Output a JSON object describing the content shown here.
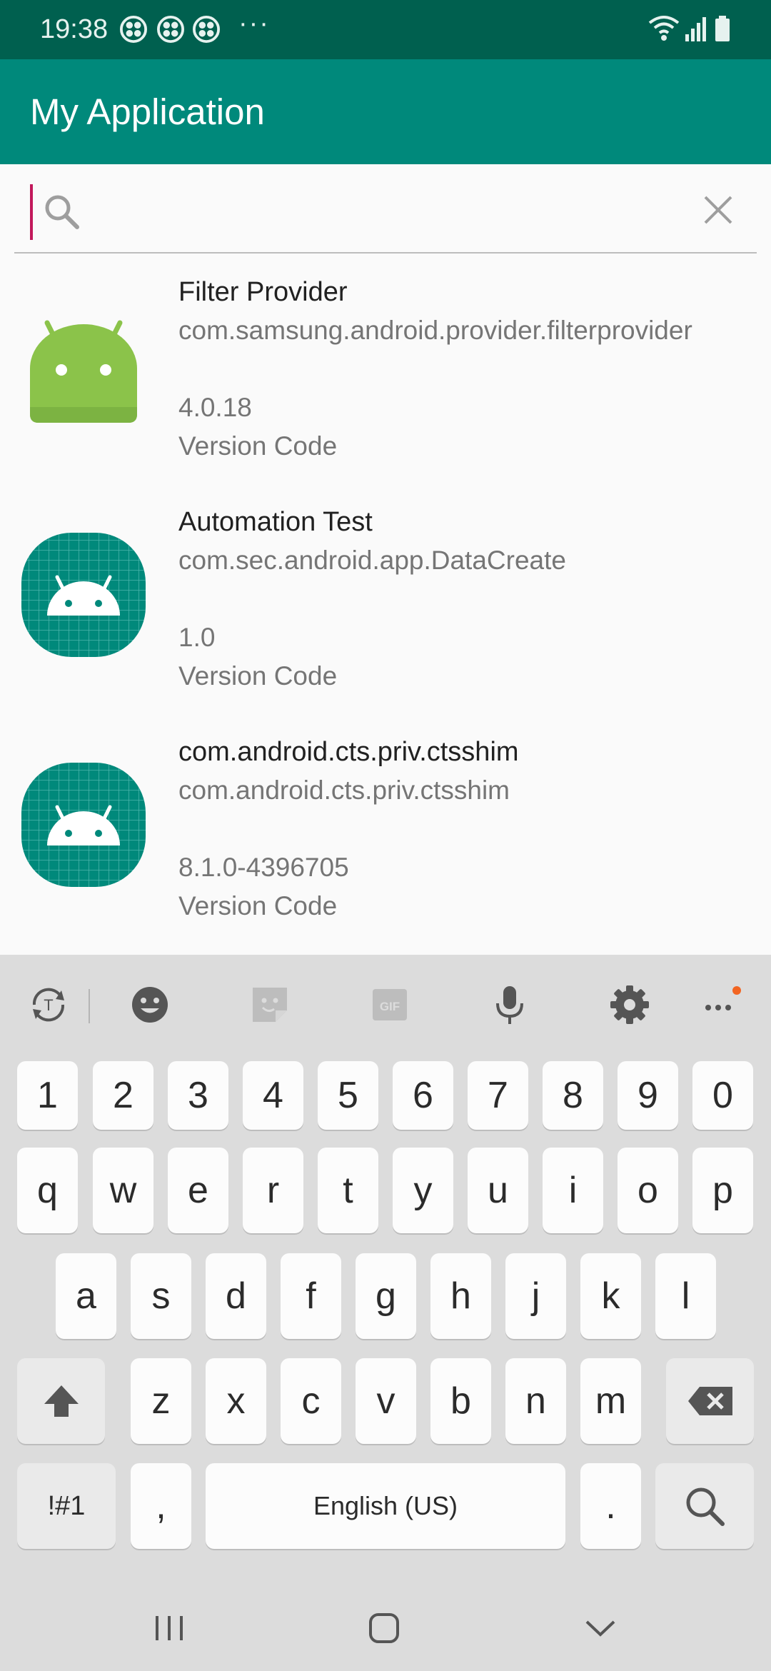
{
  "status_bar": {
    "time": "19:38",
    "notification_icons": [
      "clover-icon",
      "clover-icon",
      "clover-icon"
    ],
    "more": "···",
    "system_icons": [
      "wifi-icon",
      "signal-icon",
      "battery-icon"
    ]
  },
  "app_bar": {
    "title": "My Application"
  },
  "search": {
    "value": "",
    "placeholder": ""
  },
  "apps": [
    {
      "name": "Filter Provider",
      "package": "com.samsung.android.provider.filterprovider",
      "version": "4.0.18",
      "code_label": "Version Code",
      "icon": "android-robot-icon"
    },
    {
      "name": "Automation Test",
      "package": "com.sec.android.app.DataCreate",
      "version": "1.0",
      "code_label": "Version Code",
      "icon": "android-grid-icon"
    },
    {
      "name": "com.android.cts.priv.ctsshim",
      "package": "com.android.cts.priv.ctsshim",
      "version": "8.1.0-4396705",
      "code_label": "Version Code",
      "icon": "android-grid-icon"
    }
  ],
  "keyboard": {
    "toolbar": [
      "translate-icon",
      "emoji-icon",
      "sticker-icon",
      "gif-icon",
      "mic-icon",
      "settings-icon",
      "more-icon"
    ],
    "gif_label": "GIF",
    "row_numbers": [
      "1",
      "2",
      "3",
      "4",
      "5",
      "6",
      "7",
      "8",
      "9",
      "0"
    ],
    "row_1": [
      "q",
      "w",
      "e",
      "r",
      "t",
      "y",
      "u",
      "i",
      "o",
      "p"
    ],
    "row_2": [
      "a",
      "s",
      "d",
      "f",
      "g",
      "h",
      "j",
      "k",
      "l"
    ],
    "row_3": [
      "z",
      "x",
      "c",
      "v",
      "b",
      "n",
      "m"
    ],
    "symbols_key": "!#1",
    "comma_key": ",",
    "space_key": "English (US)",
    "period_key": ".",
    "colors": {
      "background": "#dcdcdc",
      "key": "#fcfcfc",
      "special_key": "#eaeaea"
    }
  },
  "nav_bar": [
    "recents-icon",
    "home-icon",
    "back-icon"
  ],
  "colors": {
    "status_bar": "#00604f",
    "app_bar": "#00897b",
    "cursor": "#c2185b",
    "android_green": "#8bc34a",
    "teal_icon": "#00897b"
  }
}
